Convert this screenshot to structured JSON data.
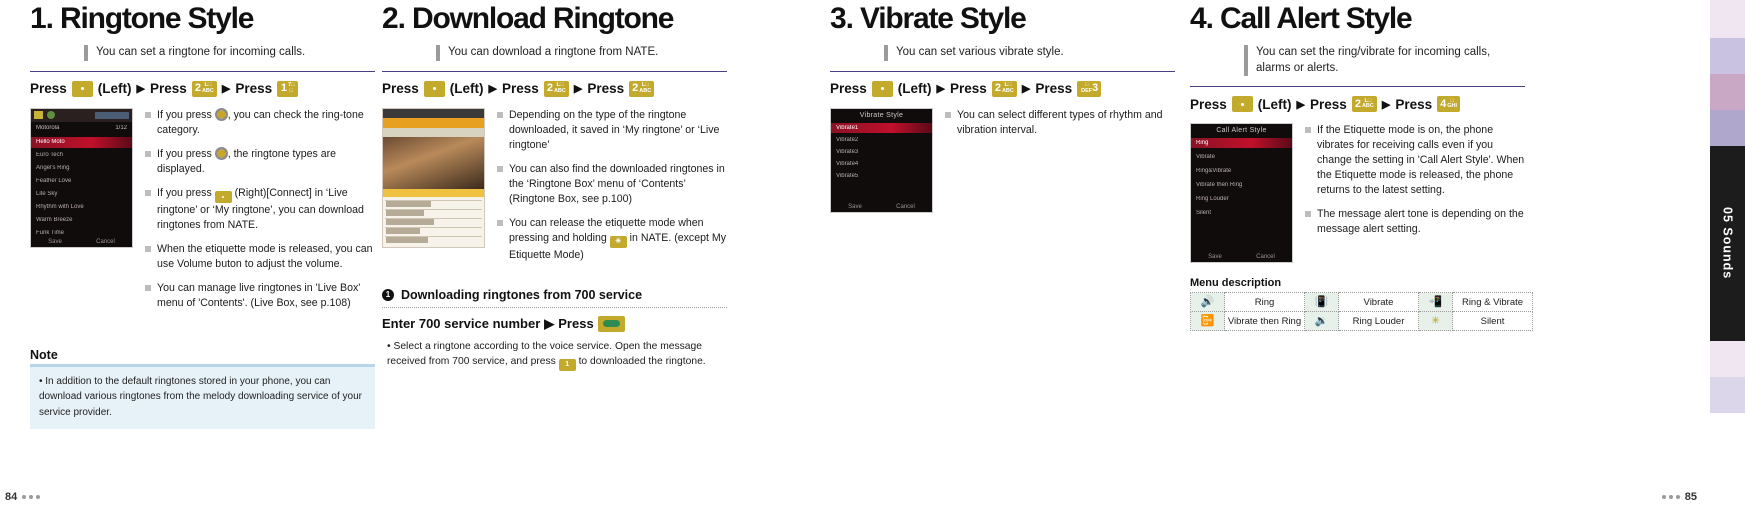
{
  "sidebar": {
    "tab_label": "05 Sounds"
  },
  "pages": {
    "left": "84",
    "right": "85"
  },
  "sections": [
    {
      "number": "1.",
      "title": "Ringtone Style",
      "subtitle": "You can set a ringtone for incoming calls.",
      "press": {
        "label1": "Press",
        "key1": "•",
        "paren": "(Left)",
        "label2": "Press",
        "key2_big": "2",
        "key2_sub": "LD\nABC",
        "label3": "Press",
        "key3_big": "1",
        "key3_sub": "73"
      },
      "screenshot": {
        "title": "Motorola",
        "counter": "1/12",
        "rows": [
          "Hello Moto",
          "Euro Tech",
          "Angel's Ring",
          "Feather Love",
          "Lite Sky",
          "Rhythm with Love",
          "Warm Breeze",
          "Funk Time"
        ],
        "soft_left": "Save",
        "soft_right": "Cancel"
      },
      "bullets": [
        "If you press ■, you can check the ring-tone category.",
        "If you press ■, the ringtone types are displayed.",
        "If you press ■ (Right)[Connect] in 'Live ringtone' or 'My ringtone', you can download ringtones from NATE.",
        "When the etiquette mode is released, you can use Volume buton to adjust the volume.",
        "You can manage live ringtones in 'Live Box' menu of 'Contents'. (Live Box, see p.108)"
      ],
      "bullets_parts": [
        [
          "If you press ",
          "navkey",
          ", you can check the ring-tone category."
        ],
        [
          "If you press ",
          "navkey",
          ", the ringtone types are displayed."
        ],
        [
          "If you press ",
          "dotkey",
          " (Right)[Connect] in 'Live ringtone' or 'My ringtone', you can download ringtones from NATE."
        ],
        [
          "When the etiquette mode is released, you can use Volume buton to adjust the volume."
        ],
        [
          "You can manage live ringtones in 'Live Box' menu of 'Contents'. (Live Box, see p.108)"
        ]
      ],
      "note": {
        "title": "Note",
        "text": "• In addition to the default ringtones stored in your phone, you can download various ringtones from the melody downloading service of your service provider."
      }
    },
    {
      "number": "2.",
      "title": "Download Ringtone",
      "subtitle": "You can download a ringtone from NATE.",
      "press": {
        "label1": "Press",
        "key1": "•",
        "paren": "(Left)",
        "label2": "Press",
        "key2_big": "2",
        "key2_sub": "LD\nABC",
        "label3": "Press",
        "key3_big": "2",
        "key3_sub": "LD\nABC"
      },
      "bullets_parts": [
        [
          "Depending on the type of the ringtone downloaded, it saved in 'My ringtone' or 'Live ringtone'"
        ],
        [
          "You can also find the downloaded ringtones in the 'Ringtone Box' menu of 'Contents' (Ringtone Box, see p.100)"
        ],
        [
          "You can release the etiquette mode when pressing and holding ",
          "starkey",
          " in NATE. (except My Etiquette Mode)"
        ]
      ],
      "subsection": {
        "num": "❶",
        "head": "Downloading ringtones from 700 service",
        "line2_a": "Enter 700 service number",
        "line2_arrow": "▶",
        "line2_b": "Press",
        "bullet": "• Select a ringtone according to the voice service. Open the message received from 700 service, and press ■ to downloaded the ringtone."
      }
    },
    {
      "number": "3.",
      "title": "Vibrate Style",
      "subtitle": "You can set various vibrate style.",
      "press": {
        "label1": "Press",
        "key1": "•",
        "paren": "(Left)",
        "label2": "Press",
        "key2_big": "2",
        "key2_sub": "LD\nABC",
        "label3": "Press",
        "key3_big": "3",
        "key3_sub": "DEF"
      },
      "screenshot": {
        "title": "Vibrate Style",
        "rows": [
          "Vibrate1",
          "Vibrate2",
          "Vibrate3",
          "Vibrate4",
          "Vibrate5"
        ],
        "soft_left": "Save",
        "soft_right": "Cancel"
      },
      "bullets_parts": [
        [
          "You can select different types of rhythm and vibration interval."
        ]
      ]
    },
    {
      "number": "4.",
      "title": "Call Alert Style",
      "subtitle": "You can set the ring/vibrate for incoming calls, alarms or alerts.",
      "press": {
        "label1": "Press",
        "key1": "•",
        "paren": "(Left)",
        "label2": "Press",
        "key2_big": "2",
        "key2_sub": "LD\nABC",
        "label3": "Press",
        "key3_big": "4",
        "key3_sub": "GHI"
      },
      "screenshot": {
        "title": "Call Alert Style",
        "rows": [
          "Ring",
          "Vibrate",
          "Ring&Vibrate",
          "Vibrate then Ring",
          "Ring Louder",
          "Silent"
        ],
        "soft_left": "Save",
        "soft_right": "Cancel"
      },
      "bullets_parts": [
        [
          "If the Etiquette mode is on, the phone vibrates for receiving calls even if you change the setting in 'Call Alert Style'. When the Etiquette mode is released, the phone returns to the latest setting."
        ],
        [
          "The message alert tone is depending on the message alert setting."
        ]
      ],
      "menu_description": {
        "title": "Menu description",
        "rows": [
          [
            {
              "icon": "speaker-icon",
              "label": "Ring"
            },
            {
              "icon": "vibrate-icon",
              "label": "Vibrate"
            },
            {
              "icon": "ring-and-vibrate-icon",
              "label": "Ring & Vibrate"
            }
          ],
          [
            {
              "icon": "vibrate-then-ring-icon",
              "label": "Vibrate then Ring"
            },
            {
              "icon": "ring-louder-icon",
              "label": "Ring Louder"
            },
            {
              "icon": "silent-icon",
              "label": "Silent"
            }
          ]
        ]
      }
    }
  ]
}
